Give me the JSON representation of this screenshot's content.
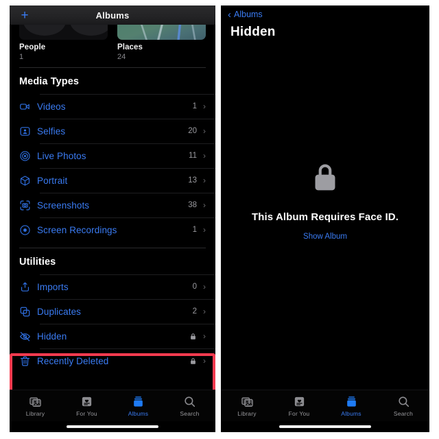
{
  "left_panel": {
    "nav": {
      "add_button": "+",
      "add_icon": "plus-icon",
      "title": "Albums"
    },
    "cards": [
      {
        "title": "People",
        "count": "1",
        "thumb": "people-collage-thumbnail"
      },
      {
        "title": "Places",
        "count": "24",
        "thumb": "map-thumbnail"
      }
    ],
    "sections": [
      {
        "header": "Media Types",
        "rows": [
          {
            "icon": "video-icon",
            "label": "Videos",
            "count": "1",
            "chevron": "›"
          },
          {
            "icon": "selfie-person-icon",
            "label": "Selfies",
            "count": "20",
            "chevron": "›"
          },
          {
            "icon": "live-photo-icon",
            "label": "Live Photos",
            "count": "11",
            "chevron": "›"
          },
          {
            "icon": "portrait-cube-icon",
            "label": "Portrait",
            "count": "13",
            "chevron": "›"
          },
          {
            "icon": "screenshot-icon",
            "label": "Screenshots",
            "count": "38",
            "chevron": "›"
          },
          {
            "icon": "screen-recording-icon",
            "label": "Screen Recordings",
            "count": "1",
            "chevron": "›"
          }
        ]
      },
      {
        "header": "Utilities",
        "rows": [
          {
            "icon": "import-tray-icon",
            "label": "Imports",
            "count": "0",
            "chevron": "›"
          },
          {
            "icon": "duplicates-icon",
            "label": "Duplicates",
            "count": "2",
            "chevron": "›"
          },
          {
            "icon": "eye-slash-icon",
            "label": "Hidden",
            "lock": "lock-icon",
            "chevron": "›"
          },
          {
            "icon": "trash-icon",
            "label": "Recently Deleted",
            "lock": "lock-icon",
            "chevron": "›"
          }
        ]
      }
    ],
    "highlight": {
      "name": "red-annotation-box",
      "color": "#f63b4f"
    },
    "tabs": [
      {
        "icon": "library-photos-icon",
        "label": "Library",
        "active": false
      },
      {
        "icon": "for-you-heart-icon",
        "label": "For You",
        "active": false
      },
      {
        "icon": "albums-stack-icon",
        "label": "Albums",
        "active": true
      },
      {
        "icon": "search-icon",
        "label": "Search",
        "active": false
      }
    ]
  },
  "right_panel": {
    "back": {
      "chevron": "‹",
      "label": "Albums"
    },
    "title": "Hidden",
    "locked": {
      "icon": "lock-icon",
      "message": "This Album Requires Face ID.",
      "action": "Show Album"
    },
    "tabs": [
      {
        "icon": "library-photos-icon",
        "label": "Library",
        "active": false
      },
      {
        "icon": "for-you-heart-icon",
        "label": "For You",
        "active": false
      },
      {
        "icon": "albums-stack-icon",
        "label": "Albums",
        "active": true
      },
      {
        "icon": "search-icon",
        "label": "Search",
        "active": false
      }
    ]
  },
  "theme": {
    "accent_blue": "#3a7bf2",
    "background": "#000000",
    "highlight_red": "#f63b4f",
    "muted_gray": "#9a9a9f"
  }
}
